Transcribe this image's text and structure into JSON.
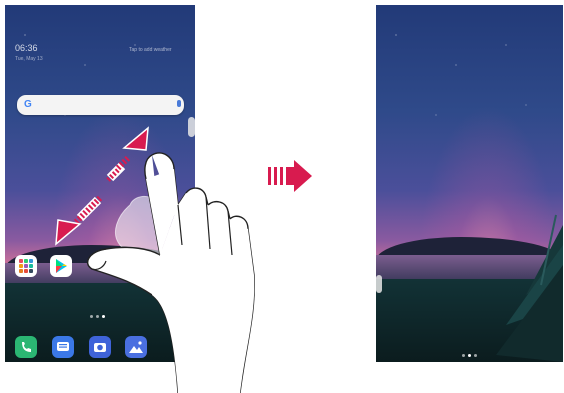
{
  "before_screen": {
    "clock": "06:36",
    "date": "Tue, May 13",
    "weather_hint": "Tap to add weather",
    "search_logo": "G",
    "apps": [
      {
        "name": "folder",
        "icon": "folder-icon"
      },
      {
        "name": "play-store",
        "icon": "play-store-icon"
      },
      {
        "name": "browser",
        "icon": "compass-icon"
      }
    ],
    "dock": [
      {
        "name": "phone",
        "icon": "phone-icon",
        "color": "#2bb673"
      },
      {
        "name": "messages",
        "icon": "message-icon",
        "color": "#3b78e7"
      },
      {
        "name": "camera",
        "icon": "camera-icon",
        "color": "#3f63d9"
      },
      {
        "name": "gallery",
        "icon": "gallery-icon",
        "color": "#4a6fe0"
      }
    ]
  },
  "transition_arrow_color": "#d81b4f",
  "gesture_arrow_color": "#d81b4f"
}
